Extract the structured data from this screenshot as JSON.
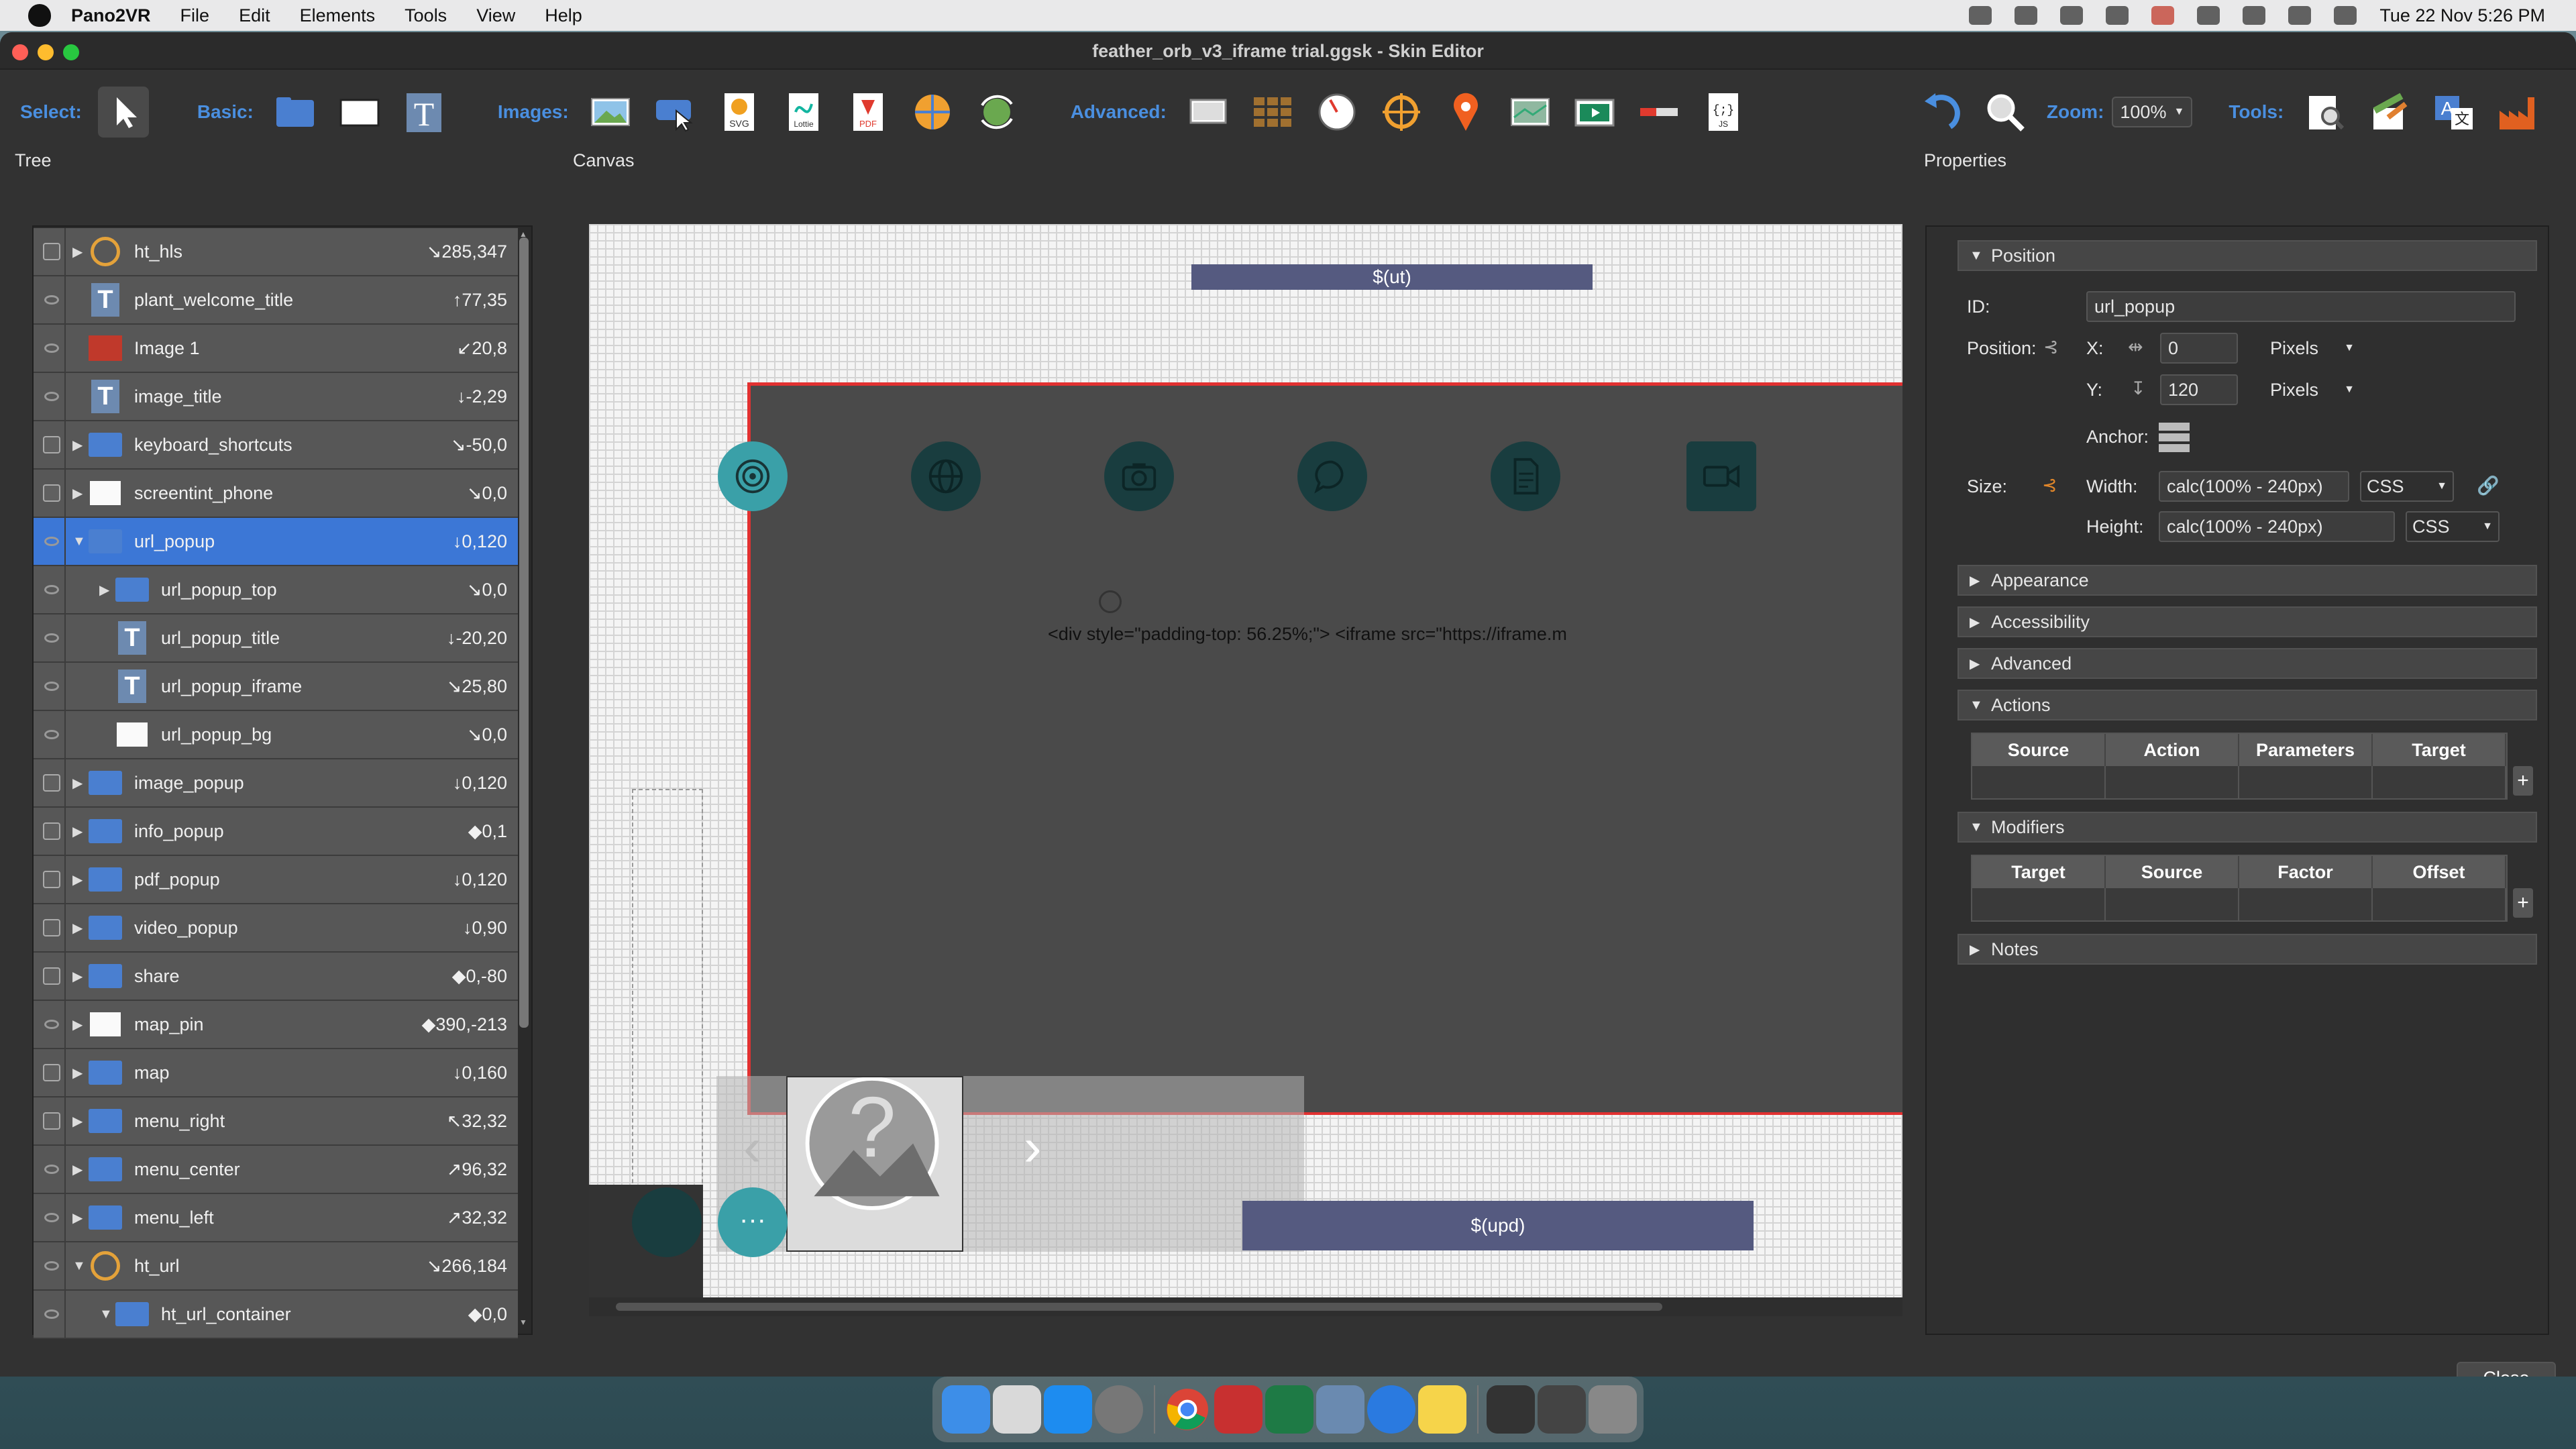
{
  "menubar": {
    "app_name": "Pano2VR",
    "items": [
      "File",
      "Edit",
      "Elements",
      "Tools",
      "View",
      "Help"
    ],
    "clock": "Tue 22 Nov  5:26 PM"
  },
  "window": {
    "title": "feather_orb_v3_iframe trial.ggsk - Skin Editor"
  },
  "toolbar": {
    "select_label": "Select:",
    "basic_label": "Basic:",
    "images_label": "Images:",
    "advanced_label": "Advanced:",
    "zoom_label": "Zoom:",
    "zoom_value": "100%",
    "tools_label": "Tools:",
    "svg_label": "SVG",
    "lottie_label": "Lottie",
    "pdf_label": "PDF",
    "js_label": "JS"
  },
  "panels": {
    "tree_title": "Tree",
    "canvas_title": "Canvas",
    "properties_title": "Properties"
  },
  "tree": {
    "items": [
      {
        "name": "ht_hls",
        "value": "↘285,347",
        "icon": "hotspot-icon",
        "expand": "▶",
        "visible": false
      },
      {
        "name": "plant_welcome_title",
        "value": "↑77,35",
        "icon": "text-icon",
        "expand": "",
        "visible": true
      },
      {
        "name": "Image 1",
        "value": "↙20,8",
        "icon": "image-icon",
        "expand": "",
        "visible": true
      },
      {
        "name": "image_title",
        "value": "↓-2,29",
        "icon": "text-icon",
        "expand": "",
        "visible": true
      },
      {
        "name": "keyboard_shortcuts",
        "value": "↘-50,0",
        "icon": "folder-icon",
        "expand": "▶",
        "visible": false
      },
      {
        "name": "screentint_phone",
        "value": "↘0,0",
        "icon": "rectangle-icon",
        "expand": "▶",
        "visible": false
      },
      {
        "name": "url_popup",
        "value": "↓0,120",
        "icon": "folder-icon",
        "expand": "▼",
        "visible": true
      },
      {
        "name": "url_popup_top",
        "value": "↘0,0",
        "icon": "folder-icon",
        "expand": "▶",
        "visible": true
      },
      {
        "name": "url_popup_title",
        "value": "↓-20,20",
        "icon": "text-icon",
        "expand": "",
        "visible": true
      },
      {
        "name": "url_popup_iframe",
        "value": "↘25,80",
        "icon": "text-icon",
        "expand": "",
        "visible": true
      },
      {
        "name": "url_popup_bg",
        "value": "↘0,0",
        "icon": "rectangle-icon",
        "expand": "",
        "visible": true
      },
      {
        "name": "image_popup",
        "value": "↓0,120",
        "icon": "folder-icon",
        "expand": "▶",
        "visible": false
      },
      {
        "name": "info_popup",
        "value": "◆0,1",
        "icon": "folder-icon",
        "expand": "▶",
        "visible": false
      },
      {
        "name": "pdf_popup",
        "value": "↓0,120",
        "icon": "folder-icon",
        "expand": "▶",
        "visible": false
      },
      {
        "name": "video_popup",
        "value": "↓0,90",
        "icon": "folder-icon",
        "expand": "▶",
        "visible": false
      },
      {
        "name": "share",
        "value": "◆0,-80",
        "icon": "folder-icon",
        "expand": "▶",
        "visible": false
      },
      {
        "name": "map_pin",
        "value": "◆390,-213",
        "icon": "rectangle-icon",
        "expand": "▶",
        "visible": true
      },
      {
        "name": "map",
        "value": "↓0,160",
        "icon": "folder-icon",
        "expand": "▶",
        "visible": false
      },
      {
        "name": "menu_right",
        "value": "↖32,32",
        "icon": "folder-icon",
        "expand": "▶",
        "visible": false
      },
      {
        "name": "menu_center",
        "value": "↗96,32",
        "icon": "folder-icon",
        "expand": "▶",
        "visible": true
      },
      {
        "name": "menu_left",
        "value": "↗32,32",
        "icon": "folder-icon",
        "expand": "▶",
        "visible": true
      },
      {
        "name": "ht_url",
        "value": "↘266,184",
        "icon": "hotspot-icon",
        "expand": "▼",
        "visible": true
      },
      {
        "name": "ht_url_container",
        "value": "◆0,0",
        "icon": "folder-icon",
        "expand": "▼",
        "visible": true
      }
    ]
  },
  "canvas": {
    "top_label": "$(ut)",
    "iframe_text": "<div style=\"padding-top: 56.25%;\"> <iframe src=\"https://iframe.m",
    "bottom_label": "$(upd)",
    "popup_icons": [
      "target-icon",
      "globe-icon",
      "camera-icon",
      "chat-icon",
      "document-icon",
      "video-icon"
    ]
  },
  "properties": {
    "position_section": "Position",
    "id_label": "ID:",
    "id_value": "url_popup",
    "position_label": "Position:",
    "x_label": "X:",
    "x_value": "0",
    "x_unit": "Pixels",
    "y_label": "Y:",
    "y_value": "120",
    "y_unit": "Pixels",
    "anchor_label": "Anchor:",
    "size_label": "Size:",
    "width_label": "Width:",
    "width_value": "calc(100% - 240px)",
    "width_unit": "CSS",
    "height_label": "Height:",
    "height_value": "calc(100% - 240px)",
    "height_unit": "CSS",
    "sections": [
      "Appearance",
      "Accessibility",
      "Advanced"
    ],
    "actions_section": "Actions",
    "actions_columns": [
      "Source",
      "Action",
      "Parameters",
      "Target"
    ],
    "modifiers_section": "Modifiers",
    "modifiers_columns": [
      "Target",
      "Source",
      "Factor",
      "Offset"
    ],
    "notes_section": "Notes",
    "close_label": "Close"
  },
  "colors": {
    "accent": "#3c77d6",
    "label_blue": "#4a8fe0",
    "selection_red": "#e23131",
    "popup_circle": "#193d3f"
  }
}
